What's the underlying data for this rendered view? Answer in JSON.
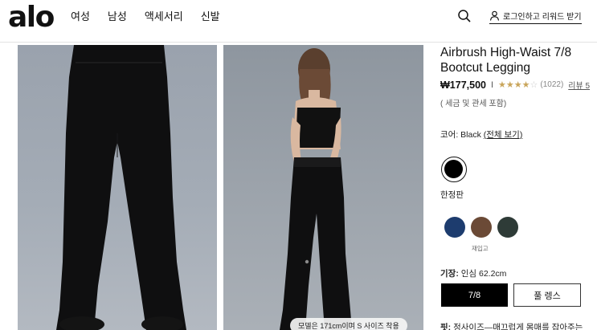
{
  "header": {
    "logo": "alo",
    "nav": [
      "여성",
      "남성",
      "액세서리",
      "신발"
    ],
    "login_label": "로그인하고 리워드 받기"
  },
  "gallery": {
    "caption": "모델은 171cm이며 S 사이즈 착용"
  },
  "product": {
    "title_line1": "Airbrush High-Waist 7/8",
    "title_line2": "Bootcut Legging",
    "price": "₩177,500",
    "separator": "I",
    "rating": 4.5,
    "stars_on": "★★★★",
    "stars_off": "☆",
    "review_count": "(1022)",
    "review_link": "리뷰 5",
    "tax_note": "( 세금 및 관세 포함)",
    "color_label": "코어: Black",
    "color_all_link": "(전체 보기)",
    "limited_label": "한정판",
    "restock_label": "재입고",
    "length_label": "기장:",
    "length_value": "인심 62.2cm",
    "size_options": [
      "7/8",
      "풀 렝스"
    ],
    "fit_label": "핏:",
    "fit_value": "정사이즈—매끄럽게 몸매를 잡아주는"
  },
  "colors": {
    "selected": "#000000",
    "swatches": [
      "#1d3c6e",
      "#6b4a36",
      "#2e3b37"
    ],
    "star": "#c9a55b"
  }
}
